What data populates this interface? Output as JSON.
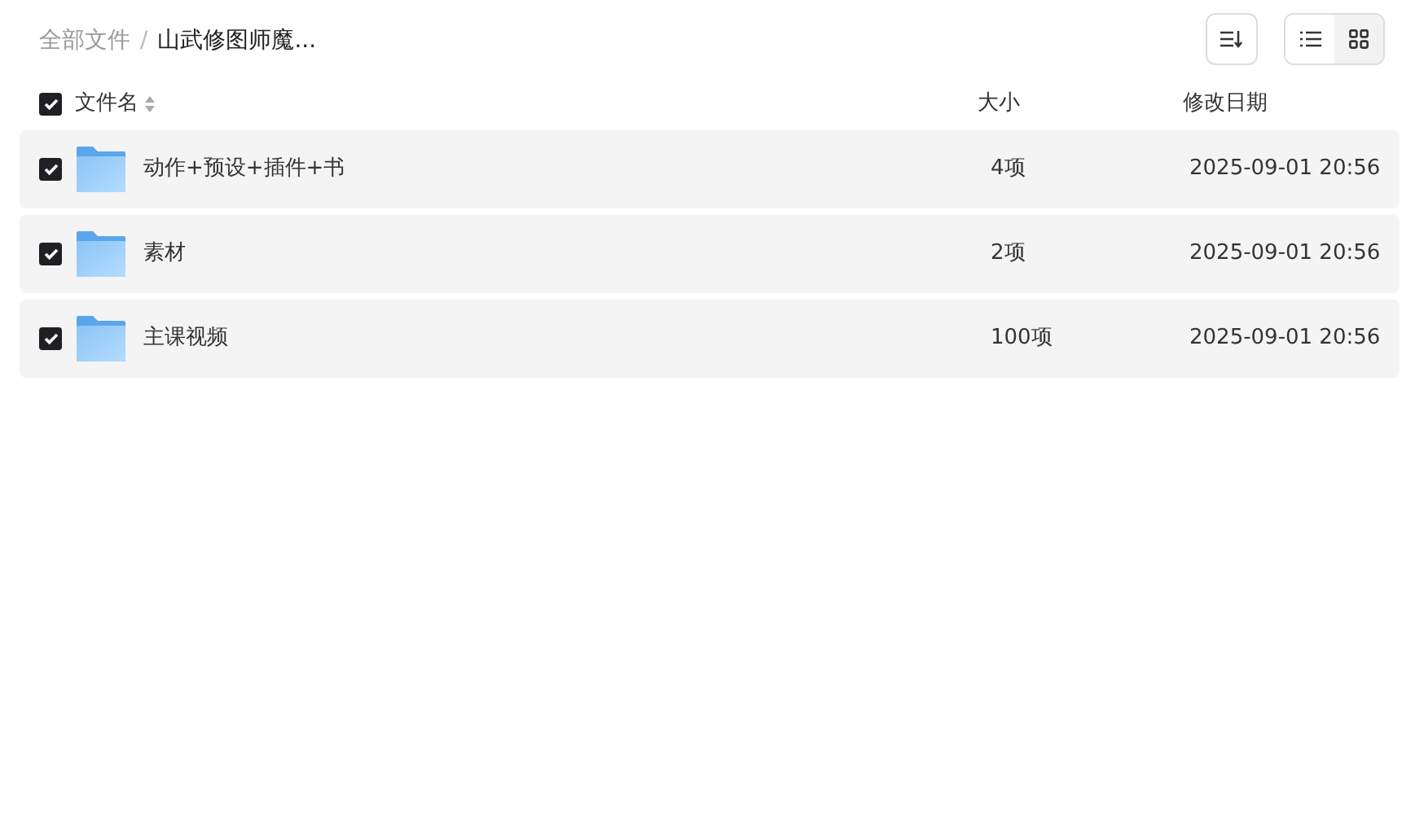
{
  "breadcrumb_separator": "/",
  "breadcrumb": [
    {
      "label": "全部文件",
      "current": false
    },
    {
      "label": "山武修图师魔...",
      "current": true
    }
  ],
  "toolbar": {
    "view_modes": [
      {
        "kind": "list",
        "selected": true
      },
      {
        "kind": "grid",
        "selected": false
      }
    ]
  },
  "header": {
    "select_all_checked": true,
    "columns": [
      "文件名",
      "大小",
      "修改日期"
    ]
  },
  "rows": [
    {
      "checked": true,
      "name": "动作+预设+插件+书",
      "size": "4项",
      "modified": "2025-09-01 20:56"
    },
    {
      "checked": true,
      "name": "素材",
      "size": "2项",
      "modified": "2025-09-01 20:56"
    },
    {
      "checked": true,
      "name": "主课视频",
      "size": "100项",
      "modified": "2025-09-01 20:56"
    }
  ]
}
